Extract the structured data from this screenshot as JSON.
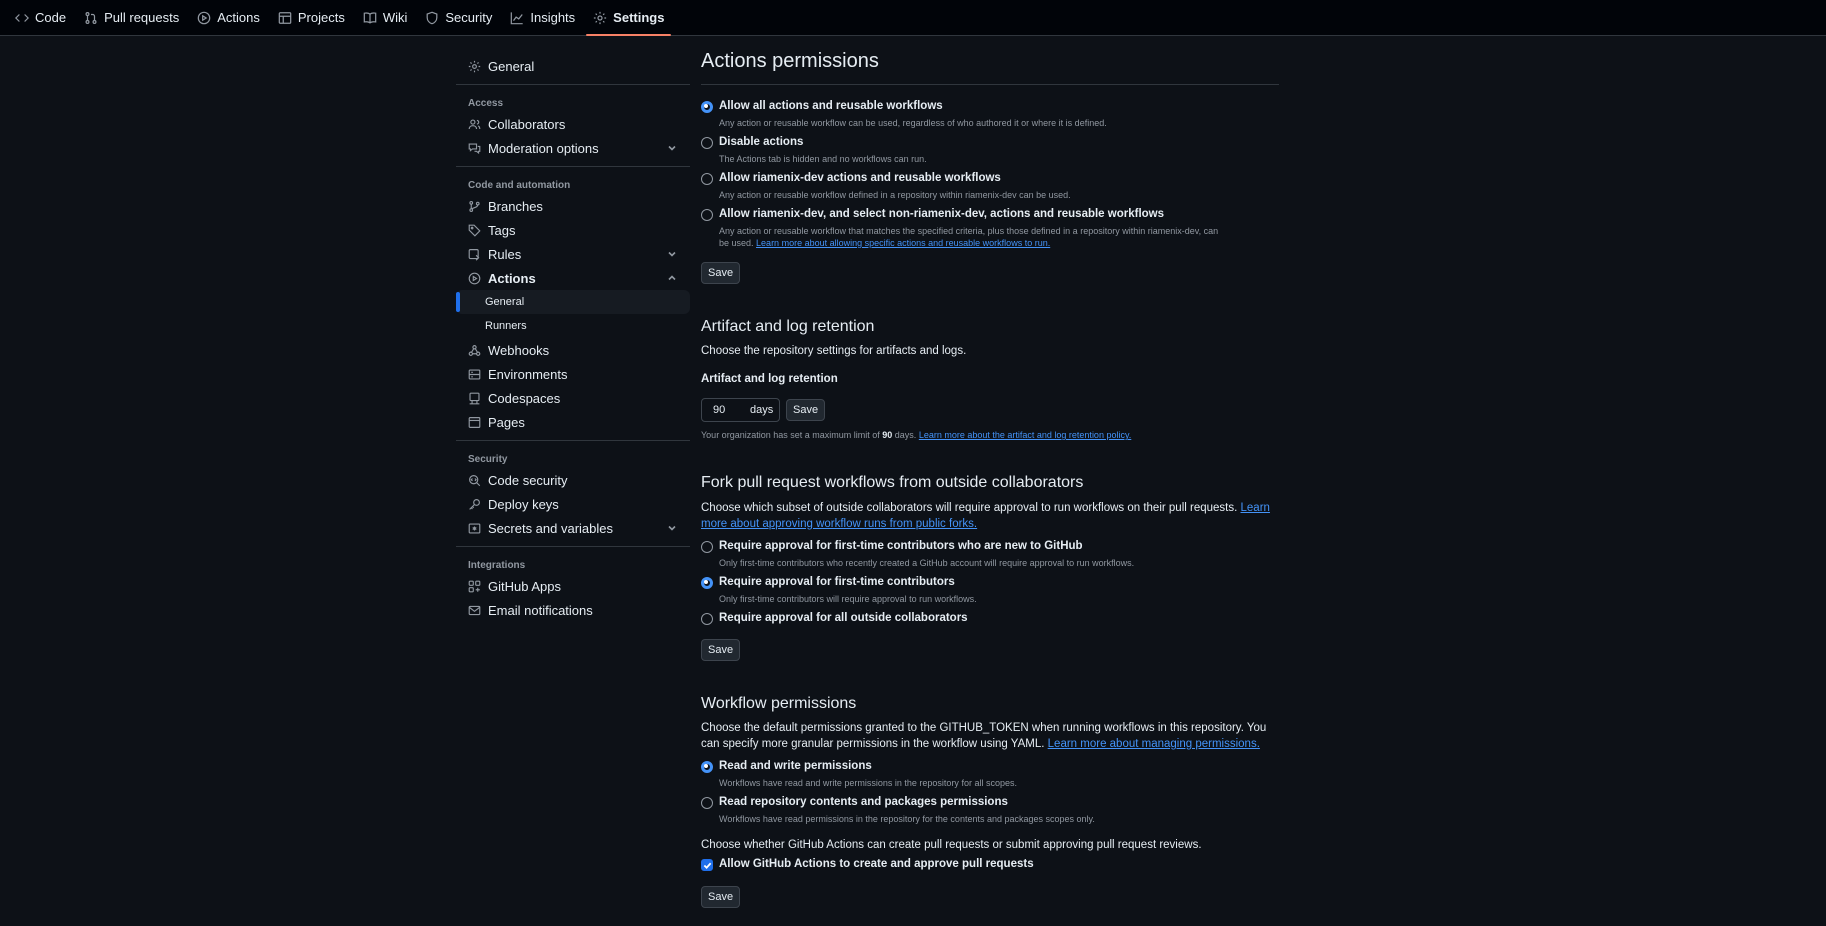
{
  "nav": {
    "tabs": [
      {
        "label": "Code",
        "icon": "code-icon"
      },
      {
        "label": "Pull requests",
        "icon": "git-pull-request-icon"
      },
      {
        "label": "Actions",
        "icon": "play-icon"
      },
      {
        "label": "Projects",
        "icon": "table-icon"
      },
      {
        "label": "Wiki",
        "icon": "book-icon"
      },
      {
        "label": "Security",
        "icon": "shield-icon"
      },
      {
        "label": "Insights",
        "icon": "graph-icon"
      },
      {
        "label": "Settings",
        "icon": "gear-icon",
        "active": true
      }
    ]
  },
  "sidebar": {
    "general": "General",
    "access_heading": "Access",
    "collaborators": "Collaborators",
    "moderation": "Moderation options",
    "code_heading": "Code and automation",
    "branches": "Branches",
    "tags": "Tags",
    "rules": "Rules",
    "actions": "Actions",
    "actions_general": "General",
    "actions_runners": "Runners",
    "webhooks": "Webhooks",
    "environments": "Environments",
    "codespaces": "Codespaces",
    "pages": "Pages",
    "security_heading": "Security",
    "code_security": "Code security",
    "deploy_keys": "Deploy keys",
    "secrets": "Secrets and variables",
    "integrations_heading": "Integrations",
    "github_apps": "GitHub Apps",
    "email_notifications": "Email notifications"
  },
  "permissions": {
    "title": "Actions permissions",
    "options": [
      {
        "label": "Allow all actions and reusable workflows",
        "hint": "Any action or reusable workflow can be used, regardless of who authored it or where it is defined.",
        "selected": true
      },
      {
        "label": "Disable actions",
        "hint": "The Actions tab is hidden and no workflows can run.",
        "selected": false
      },
      {
        "label": "Allow riamenix-dev actions and reusable workflows",
        "hint": "Any action or reusable workflow defined in a repository within riamenix-dev can be used.",
        "selected": false
      },
      {
        "label": "Allow riamenix-dev, and select non-riamenix-dev, actions and reusable workflows",
        "hint": "Any action or reusable workflow that matches the specified criteria, plus those defined in a repository within riamenix-dev, can be used.",
        "link": "Learn more about allowing specific actions and reusable workflows to run.",
        "selected": false
      }
    ],
    "save": "Save"
  },
  "artifact": {
    "title": "Artifact and log retention",
    "desc": "Choose the repository settings for artifacts and logs.",
    "field_label": "Artifact and log retention",
    "value": "90",
    "unit": "days",
    "save": "Save",
    "note_prefix": "Your organization has set a maximum limit of",
    "note_value": "90",
    "note_suffix": "days.",
    "note_link": "Learn more about the artifact and log retention policy."
  },
  "fork": {
    "title": "Fork pull request workflows from outside collaborators",
    "desc": "Choose which subset of outside collaborators will require approval to run workflows on their pull requests.",
    "desc_link": "Learn more about approving workflow runs from public forks.",
    "options": [
      {
        "label": "Require approval for first-time contributors who are new to GitHub",
        "hint": "Only first-time contributors who recently created a GitHub account will require approval to run workflows.",
        "selected": false
      },
      {
        "label": "Require approval for first-time contributors",
        "hint": "Only first-time contributors will require approval to run workflows.",
        "selected": true
      },
      {
        "label": "Require approval for all outside collaborators",
        "hint": "",
        "selected": false
      }
    ],
    "save": "Save"
  },
  "workflow": {
    "title": "Workflow permissions",
    "desc": "Choose the default permissions granted to the GITHUB_TOKEN when running workflows in this repository. You can specify more granular permissions in the workflow using YAML.",
    "desc_link": "Learn more about managing permissions.",
    "options": [
      {
        "label": "Read and write permissions",
        "hint": "Workflows have read and write permissions in the repository for all scopes.",
        "selected": true
      },
      {
        "label": "Read repository contents and packages permissions",
        "hint": "Workflows have read permissions in the repository for the contents and packages scopes only.",
        "selected": false
      }
    ],
    "pr_desc": "Choose whether GitHub Actions can create pull requests or submit approving pull request reviews.",
    "pr_checkbox": "Allow GitHub Actions to create and approve pull requests",
    "pr_checked": true,
    "save": "Save"
  }
}
